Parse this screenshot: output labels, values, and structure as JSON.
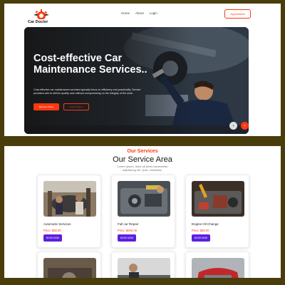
{
  "brand": {
    "name": "Car Doctor"
  },
  "nav": {
    "links": [
      "Home",
      "About",
      "Login"
    ],
    "appointment_label": "Appointment"
  },
  "hero": {
    "title": "Cost-effective Car Maintenance Services..",
    "description": "Cost-effective car maintenance services typically focus on efficiency and practicality. Service providers aim to deliver quality care without compromising on the integrity of the work.",
    "primary_button": "Discover More",
    "secondary_button": "Latest Project",
    "prev_icon": "arrow-left-icon",
    "next_icon": "arrow-right-icon"
  },
  "services": {
    "eyebrow": "Our Services",
    "heading": "Our Service Area",
    "subtitle": "Lorem ipsum, dolor sit amet consectetur adipisicing elit. Quis, molestiae.",
    "cards": [
      {
        "title": "Automatic Services",
        "price": "Price: $30.00",
        "button": "BOOK NOW"
      },
      {
        "title": "Full car Repair",
        "price": "Price: $200.00",
        "button": "BOOK NOW"
      },
      {
        "title": "Engine Oil Change",
        "price": "Price: $20.00",
        "button": "BOOK NOW"
      }
    ]
  },
  "colors": {
    "accent": "#ff3811",
    "button_purple": "#5b1fe0",
    "frame": "#4a3d0c"
  }
}
